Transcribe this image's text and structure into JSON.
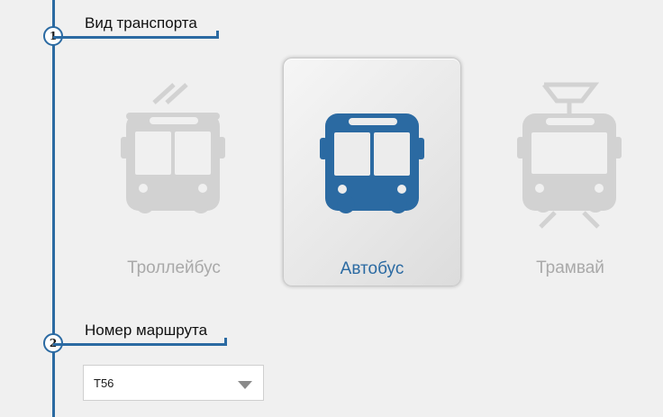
{
  "steps": [
    {
      "number": "1",
      "title": "Вид транспорта"
    },
    {
      "number": "2",
      "title": "Номер маршрута"
    }
  ],
  "transport_options": [
    {
      "label": "Троллейбус",
      "icon": "trolleybus-icon",
      "selected": false
    },
    {
      "label": "Автобус",
      "icon": "bus-icon",
      "selected": true
    },
    {
      "label": "Трамвай",
      "icon": "tram-icon",
      "selected": false
    }
  ],
  "route": {
    "selected_value": "Т56"
  },
  "colors": {
    "accent": "#2b6aa2",
    "inactive_icon": "#d2d2d2",
    "inactive_label": "#a9a9a9",
    "background": "#f0f0f0"
  }
}
